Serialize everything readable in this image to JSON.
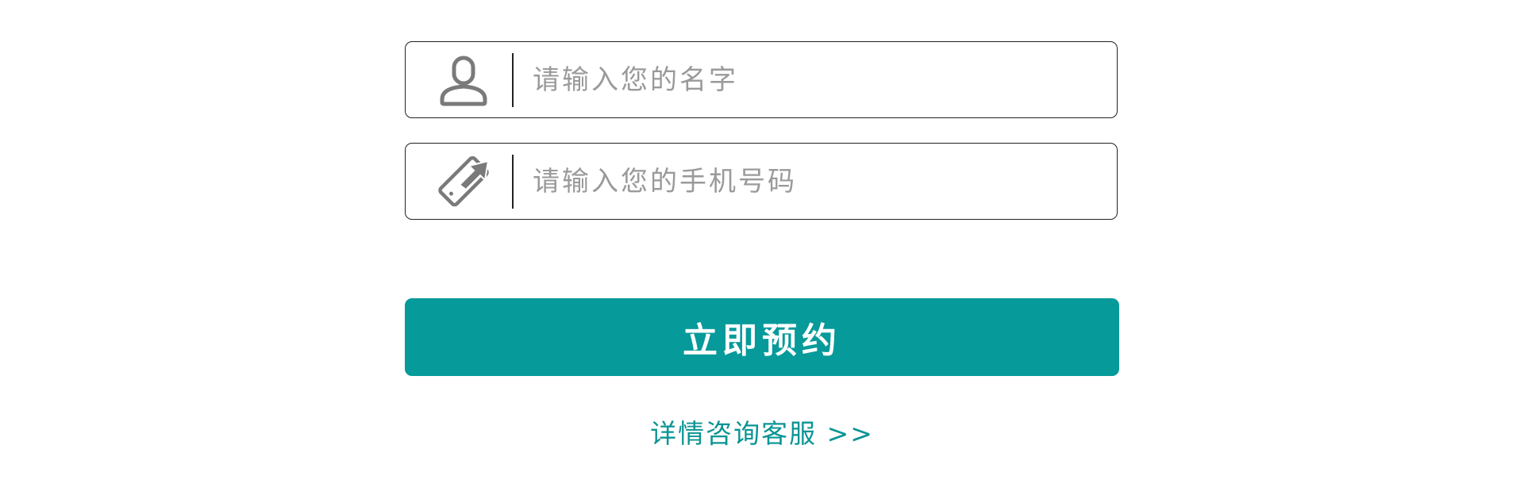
{
  "form": {
    "name_placeholder": "请输入您的名字",
    "name_value": "",
    "name_icon": "user-icon",
    "phone_placeholder": "请输入您的手机号码",
    "phone_value": "",
    "phone_icon": "phone-call-icon",
    "submit_label": "立即预约",
    "consult_link": "详情咨询客服 >>"
  },
  "colors": {
    "accent": "#079a9a",
    "icon": "#7a7a7a",
    "placeholder": "#9a9a9a"
  }
}
